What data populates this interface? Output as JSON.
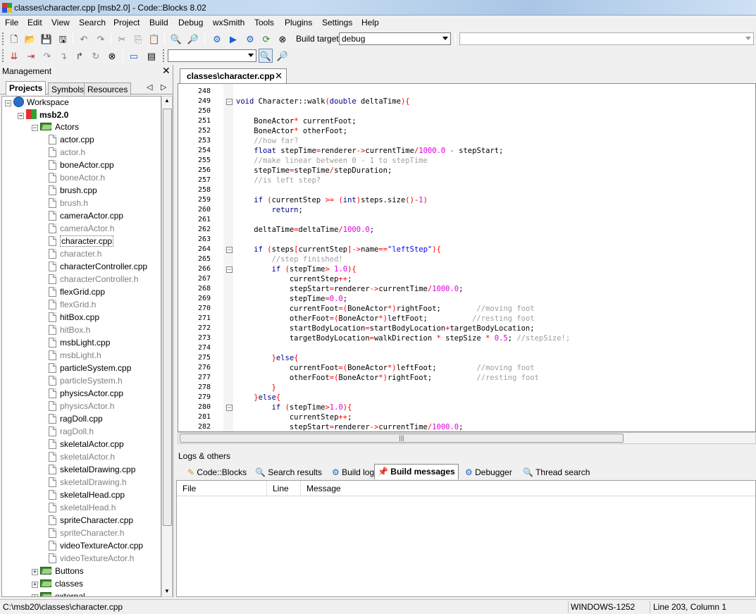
{
  "window": {
    "title": "classes\\character.cpp [msb2.0] - Code::Blocks 8.02"
  },
  "menu": [
    "File",
    "Edit",
    "View",
    "Search",
    "Project",
    "Build",
    "Debug",
    "wxSmith",
    "Tools",
    "Plugins",
    "Settings",
    "Help"
  ],
  "toolbar": {
    "build_target_label": "Build target:",
    "build_target_value": "debug",
    "search_combo_value": ""
  },
  "management": {
    "title": "Management",
    "tabs": [
      "Projects",
      "Symbols",
      "Resources"
    ],
    "tree": {
      "workspace": "Workspace",
      "project": "msb2.0",
      "folder_actors": "Actors",
      "files": [
        "actor.cpp",
        "actor.h",
        "boneActor.cpp",
        "boneActor.h",
        "brush.cpp",
        "brush.h",
        "cameraActor.cpp",
        "cameraActor.h",
        "character.cpp",
        "character.h",
        "characterController.cpp",
        "characterController.h",
        "flexGrid.cpp",
        "flexGrid.h",
        "hitBox.cpp",
        "hitBox.h",
        "msbLight.cpp",
        "msbLight.h",
        "particleSystem.cpp",
        "particleSystem.h",
        "physicsActor.cpp",
        "physicsActor.h",
        "ragDoll.cpp",
        "ragDoll.h",
        "skeletalActor.cpp",
        "skeletalActor.h",
        "skeletalDrawing.cpp",
        "skeletalDrawing.h",
        "skeletalHead.cpp",
        "skeletalHead.h",
        "spriteCharacter.cpp",
        "spriteCharacter.h",
        "videoTextureActor.cpp",
        "videoTextureActor.h"
      ],
      "folder_buttons": "Buttons",
      "folder_classes": "classes",
      "folder_external": "external"
    }
  },
  "editor": {
    "tab_label": "classes\\character.cpp",
    "line_numbers": [
      "248",
      "249",
      "250",
      "251",
      "252",
      "253",
      "254",
      "255",
      "256",
      "257",
      "258",
      "259",
      "260",
      "261",
      "262",
      "263",
      "264",
      "265",
      "266",
      "267",
      "268",
      "269",
      "270",
      "271",
      "272",
      "273",
      "274",
      "275",
      "276",
      "277",
      "278",
      "279",
      "280",
      "281",
      "282"
    ],
    "lines": [
      "",
      "void Character::walk(double deltaTime){",
      "",
      "    BoneActor* currentFoot;",
      "    BoneActor* otherFoot;",
      "    //how far?",
      "    float stepTime=renderer->currentTime/1000.0 - stepStart;",
      "    //make linear between 0 - 1 to stepTime",
      "    stepTime=stepTime/stepDuration;",
      "    //is left step?",
      "",
      "    if (currentStep >= (int)steps.size()-1)",
      "        return;",
      "",
      "    deltaTime=deltaTime/1000.0;",
      "",
      "    if (steps[currentStep]->name==\"leftStep\"){",
      "        //step finished!",
      "        if (stepTime> 1.0){",
      "            currentStep++;",
      "            stepStart=renderer->currentTime/1000.0;",
      "            stepTime=0.0;",
      "            currentFoot=(BoneActor*)rightFoot;        //moving foot",
      "            otherFoot=(BoneActor*)leftFoot;          //resting foot",
      "            startBodyLocation=startBodyLocation+targetBodyLocation;",
      "            targetBodyLocation=walkDirection * stepSize * 0.5; //stepSize!;",
      "",
      "        }else{",
      "            currentFoot=(BoneActor*)leftFoot;         //moving foot",
      "            otherFoot=(BoneActor*)rightFoot;          //resting foot",
      "        }",
      "    }else{",
      "        if (stepTime>1.0){",
      "            currentStep++;",
      "            stepStart=renderer->currentTime/1000.0;"
    ]
  },
  "logs": {
    "title": "Logs & others",
    "tabs": [
      "Code::Blocks",
      "Search results",
      "Build log",
      "Build messages",
      "Debugger",
      "Thread search"
    ],
    "columns": [
      "File",
      "Line",
      "Message"
    ]
  },
  "status": {
    "path": "C:\\msb20\\classes\\character.cpp",
    "encoding": "WINDOWS-1252",
    "position": "Line 203, Column 1"
  }
}
